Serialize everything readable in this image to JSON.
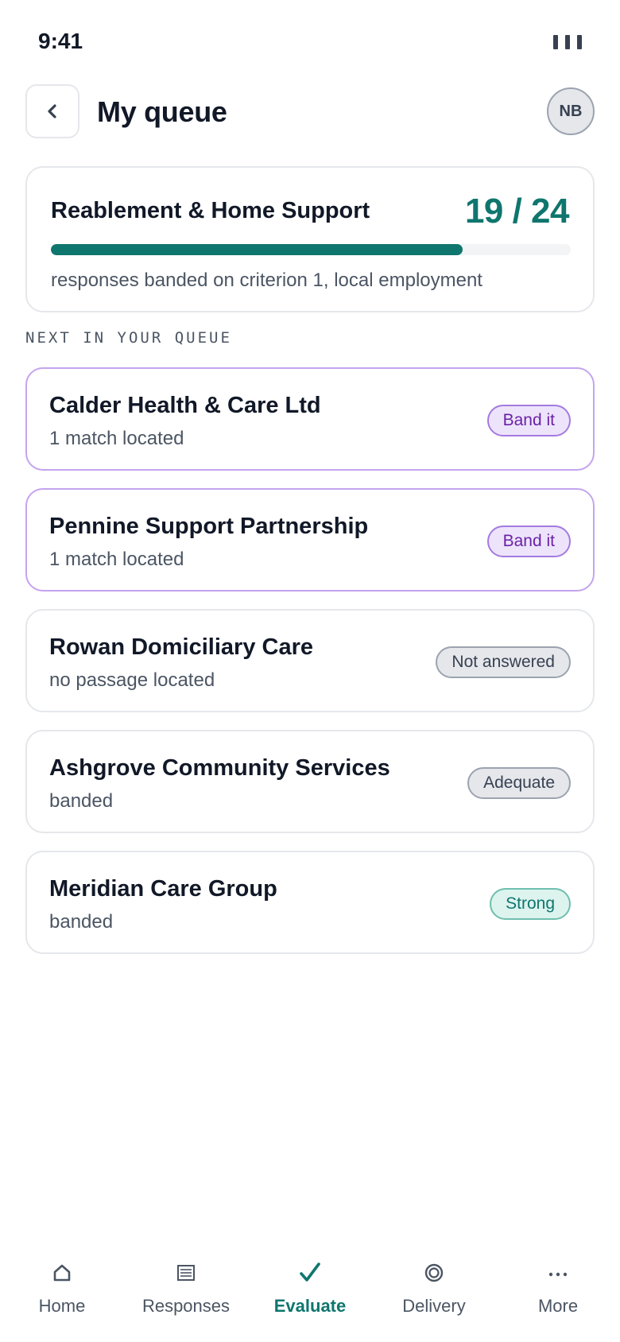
{
  "status_bar": {
    "time": "9:41"
  },
  "header": {
    "title": "My queue",
    "avatar_initials": "NB"
  },
  "progress": {
    "lot_name": "Reablement & Home Support",
    "count_label": "19 / 24",
    "banded": 19,
    "total": 24,
    "caption": "responses banded on criterion 1, local employment"
  },
  "section_label": "NEXT IN YOUR QUEUE",
  "queue": [
    {
      "name": "Calder Health & Care Ltd",
      "sub": "1 match located",
      "badge": "Band it",
      "state": "pending"
    },
    {
      "name": "Pennine Support Partnership",
      "sub": "1 match located",
      "badge": "Band it",
      "state": "pending"
    },
    {
      "name": "Rowan Domiciliary Care",
      "sub": "no passage located",
      "badge": "Not answered",
      "state": "neutral"
    },
    {
      "name": "Ashgrove Community Services",
      "sub": "banded",
      "badge": "Adequate",
      "state": "neutral"
    },
    {
      "name": "Meridian Care Group",
      "sub": "banded",
      "badge": "Strong",
      "state": "strong"
    }
  ],
  "tabs": [
    {
      "label": "Home",
      "icon": "home-icon"
    },
    {
      "label": "Responses",
      "icon": "list-icon"
    },
    {
      "label": "Evaluate",
      "icon": "check-icon",
      "active": true
    },
    {
      "label": "Delivery",
      "icon": "target-icon"
    },
    {
      "label": "More",
      "icon": "more-icon"
    }
  ],
  "colors": {
    "accent": "#0f766e",
    "band_purple": "#6b21a8",
    "border": "#e5e7eb"
  }
}
